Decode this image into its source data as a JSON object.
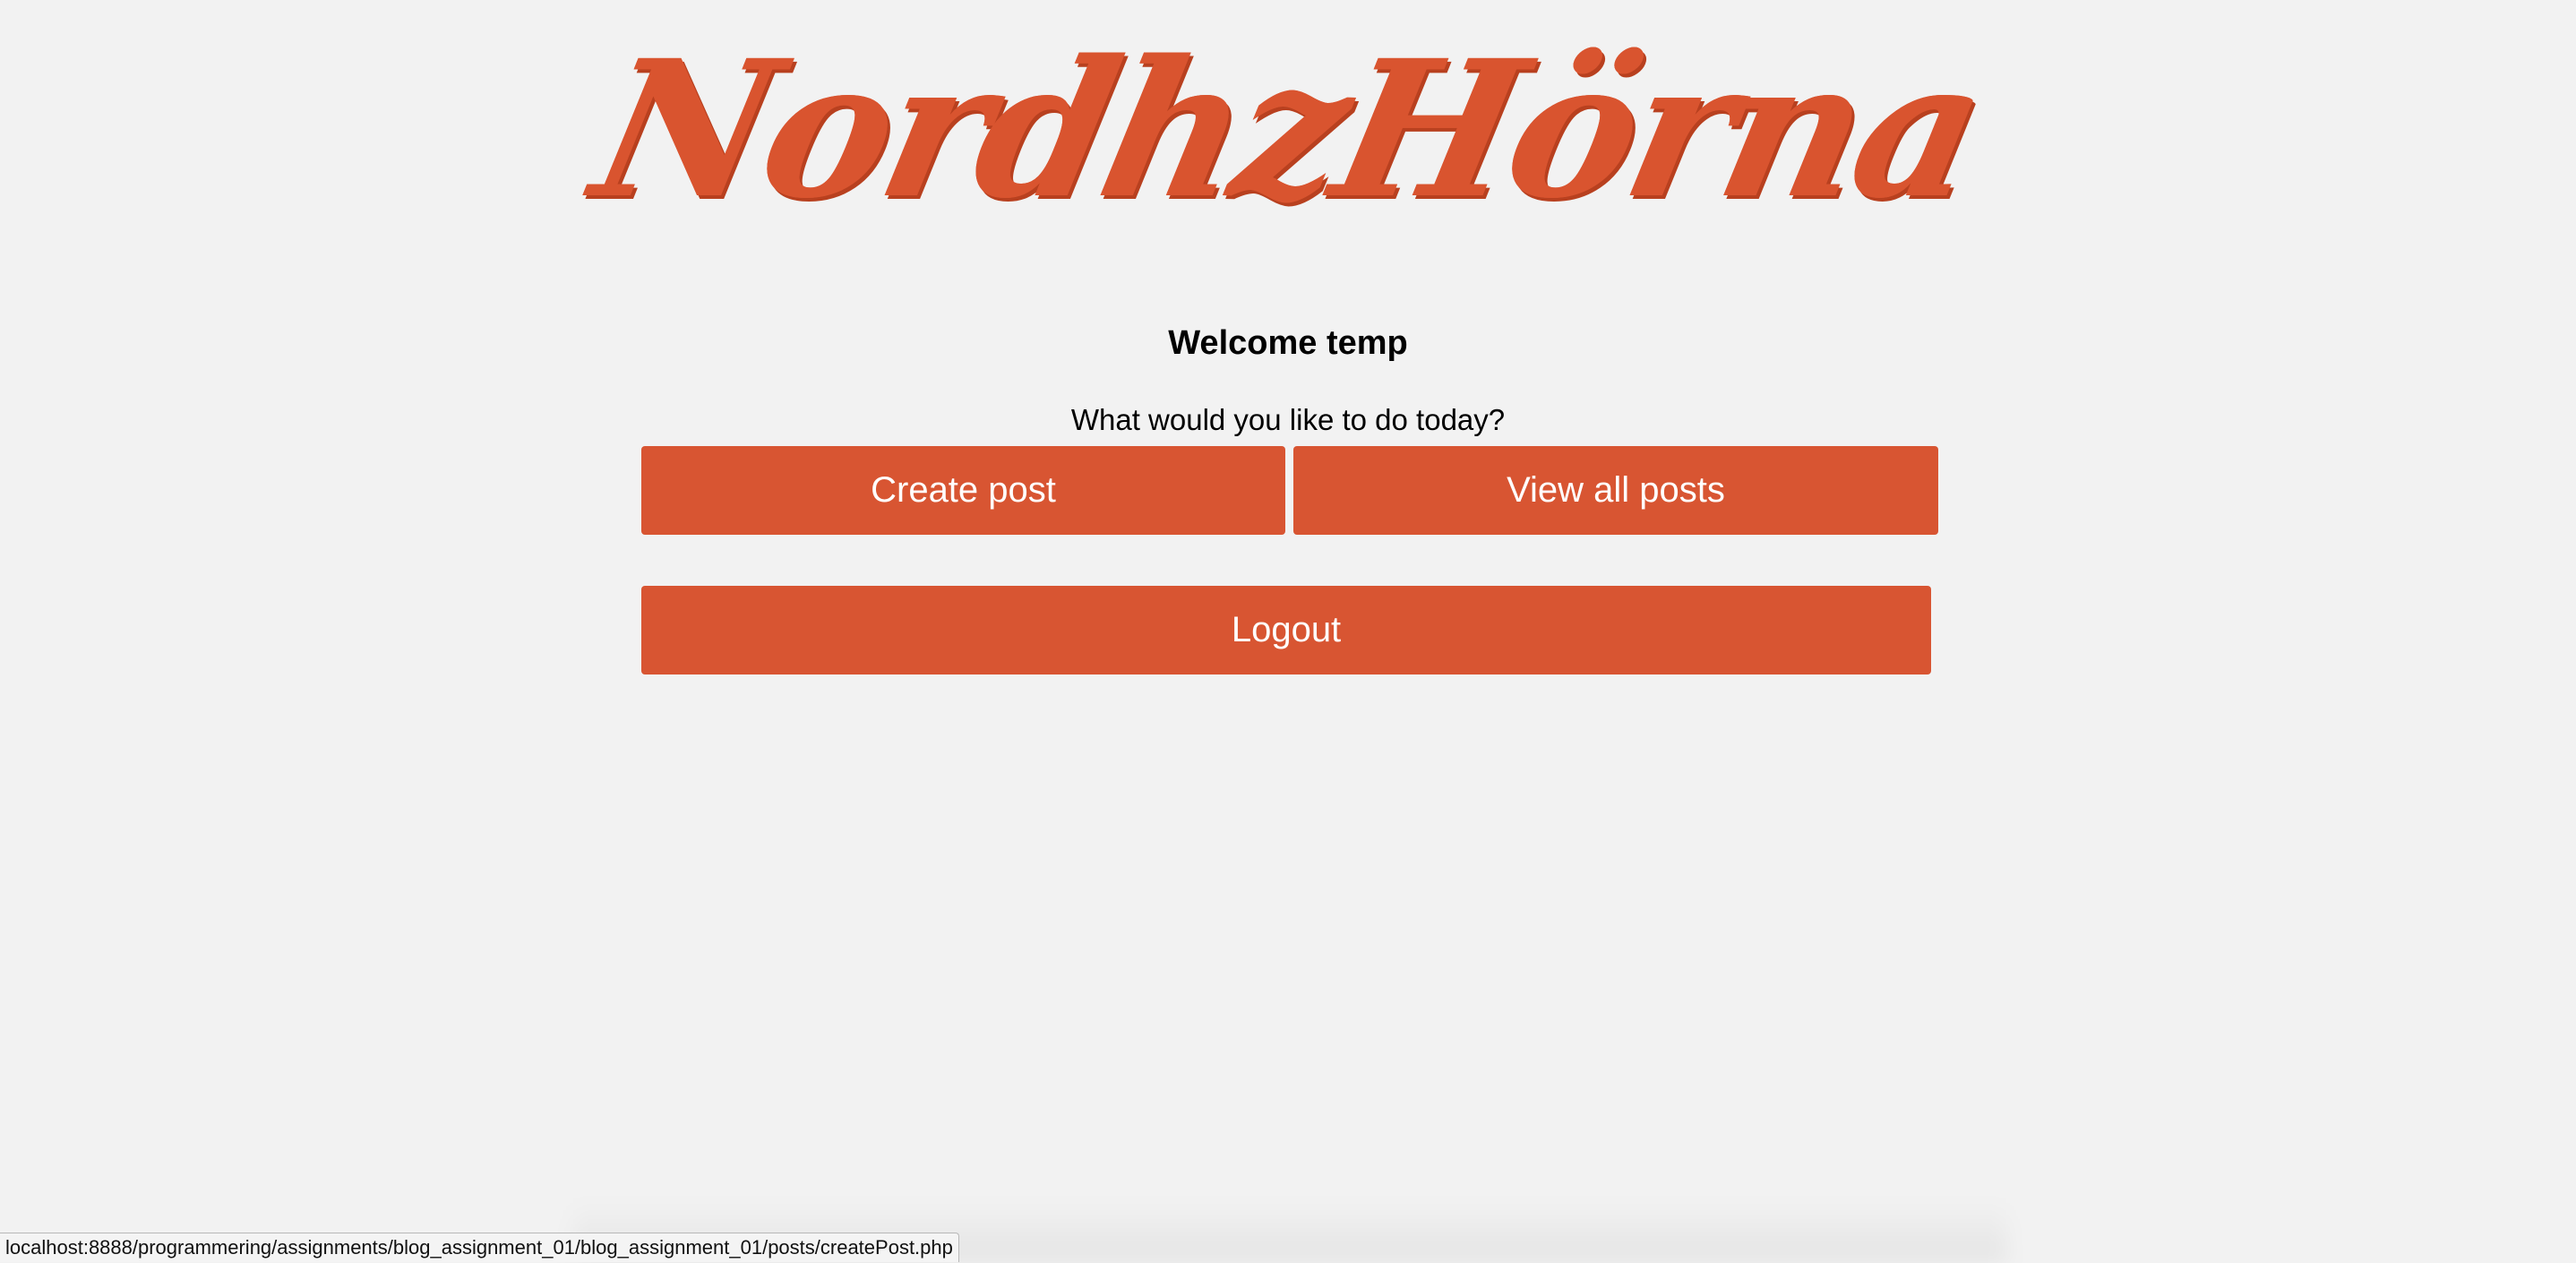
{
  "header": {
    "logo_text": "NordhzHörna"
  },
  "main": {
    "welcome_heading": "Welcome temp",
    "prompt_text": "What would you like to do today?",
    "create_post_label": "Create post",
    "view_all_posts_label": "View all posts",
    "logout_label": "Logout"
  },
  "status_bar": {
    "hover_url": "localhost:8888/programmering/assignments/blog_assignment_01/blog_assignment_01/posts/createPost.php"
  },
  "colors": {
    "accent": "#d85532",
    "background": "#f2f2f2",
    "button_text": "#ffffff"
  }
}
